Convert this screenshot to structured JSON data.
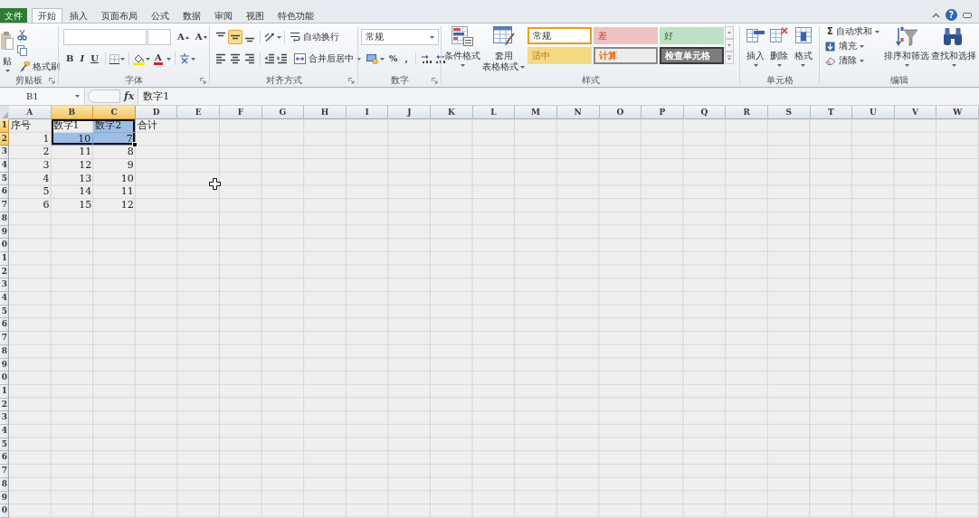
{
  "tabs": [
    {
      "label": "文件",
      "kind": "file",
      "selected": false
    },
    {
      "label": "开始",
      "kind": "tab",
      "selected": true
    },
    {
      "label": "插入",
      "kind": "tab",
      "selected": false
    },
    {
      "label": "页面布局",
      "kind": "tab",
      "selected": false
    },
    {
      "label": "公式",
      "kind": "tab",
      "selected": false
    },
    {
      "label": "数据",
      "kind": "tab",
      "selected": false
    },
    {
      "label": "审阅",
      "kind": "tab",
      "selected": false
    },
    {
      "label": "视图",
      "kind": "tab",
      "selected": false
    },
    {
      "label": "特色功能",
      "kind": "tab",
      "selected": false
    }
  ],
  "help_button": "?",
  "clipboard": {
    "label": "剪贴板",
    "paste": "贴",
    "format_painter": "格式刷"
  },
  "font": {
    "label": "字体",
    "grow": "A",
    "shrink": "A",
    "bold": "B",
    "italic": "I",
    "underline": "U",
    "font_color": "A"
  },
  "alignment": {
    "label": "对齐方式",
    "vertical": [
      {
        "selected": false
      },
      {
        "selected": true
      },
      {
        "selected": false
      }
    ],
    "wrap_text": "自动换行",
    "merge_center": "合并后居中"
  },
  "number": {
    "label": "数字",
    "format": "常规",
    "percent": "%",
    "comma": ","
  },
  "styles": {
    "label": "样式",
    "conditional": "条件格式",
    "table_format": [
      "套用",
      "表格格式"
    ],
    "gallery": [
      {
        "label": "常规",
        "kind": "normal",
        "selected": true
      },
      {
        "label": "差",
        "kind": "bad",
        "selected": false
      },
      {
        "label": "好",
        "kind": "good",
        "selected": false
      },
      {
        "label": "适中",
        "kind": "neutral",
        "selected": false
      },
      {
        "label": "计算",
        "kind": "calculation",
        "selected": false
      },
      {
        "label": "检查单元格",
        "kind": "check",
        "selected": false
      }
    ]
  },
  "cells": {
    "label": "单元格",
    "buttons": [
      "插入",
      "删除",
      "格式"
    ]
  },
  "editing": {
    "label": "编辑",
    "autosum_symbol": "Σ",
    "small_buttons": [
      "自动求和",
      "填充",
      "清除"
    ],
    "large_buttons": [
      "排序和筛选",
      "查找和选择"
    ]
  },
  "formula_bar": {
    "name_box": "B1",
    "function_button": "fx",
    "content": "数字1"
  },
  "sheet": {
    "columns": [
      {
        "label": "A",
        "selected": false
      },
      {
        "label": "B",
        "selected": true
      },
      {
        "label": "C",
        "selected": true
      },
      {
        "label": "D",
        "selected": false
      },
      {
        "label": "E",
        "selected": false
      },
      {
        "label": "F",
        "selected": false
      },
      {
        "label": "G",
        "selected": false
      },
      {
        "label": "H",
        "selected": false
      },
      {
        "label": "I",
        "selected": false
      },
      {
        "label": "J",
        "selected": false
      },
      {
        "label": "K",
        "selected": false
      },
      {
        "label": "L",
        "selected": false
      },
      {
        "label": "M",
        "selected": false
      },
      {
        "label": "N",
        "selected": false
      },
      {
        "label": "O",
        "selected": false
      },
      {
        "label": "P",
        "selected": false
      },
      {
        "label": "Q",
        "selected": false
      },
      {
        "label": "R",
        "selected": false
      },
      {
        "label": "S",
        "selected": false
      },
      {
        "label": "T",
        "selected": false
      },
      {
        "label": "U",
        "selected": false
      },
      {
        "label": "V",
        "selected": false
      },
      {
        "label": "W",
        "selected": false
      }
    ],
    "rows": [
      {
        "header": "1",
        "selected": true,
        "kind": "text",
        "cells": [
          "序号",
          "数字1",
          "数字2",
          "合计"
        ]
      },
      {
        "header": "2",
        "selected": true,
        "kind": "number",
        "cells": [
          "1",
          "10",
          "7"
        ]
      },
      {
        "header": "3",
        "selected": false,
        "kind": "number",
        "cells": [
          "2",
          "11",
          "8"
        ]
      },
      {
        "header": "4",
        "selected": false,
        "kind": "number",
        "cells": [
          "3",
          "12",
          "9"
        ]
      },
      {
        "header": "5",
        "selected": false,
        "kind": "number",
        "cells": [
          "4",
          "13",
          "10"
        ]
      },
      {
        "header": "6",
        "selected": false,
        "kind": "number",
        "cells": [
          "5",
          "14",
          "11"
        ]
      },
      {
        "header": "7",
        "selected": false,
        "kind": "number",
        "cells": [
          "6",
          "15",
          "12"
        ]
      },
      {
        "header": "8",
        "selected": false
      },
      {
        "header": "9",
        "selected": false
      },
      {
        "header": "0",
        "selected": false
      },
      {
        "header": "1",
        "selected": false
      },
      {
        "header": "2",
        "selected": false
      },
      {
        "header": "3",
        "selected": false
      },
      {
        "header": "4",
        "selected": false
      },
      {
        "header": "5",
        "selected": false
      },
      {
        "header": "6",
        "selected": false
      },
      {
        "header": "7",
        "selected": false
      },
      {
        "header": "8",
        "selected": false
      },
      {
        "header": "9",
        "selected": false
      },
      {
        "header": "0",
        "selected": false
      },
      {
        "header": "1",
        "selected": false
      },
      {
        "header": "2",
        "selected": false
      },
      {
        "header": "3",
        "selected": false
      },
      {
        "header": "4",
        "selected": false
      },
      {
        "header": "5",
        "selected": false
      },
      {
        "header": "6",
        "selected": false
      },
      {
        "header": "7",
        "selected": false
      },
      {
        "header": "8",
        "selected": false
      },
      {
        "header": "9",
        "selected": false
      },
      {
        "header": "0",
        "selected": false
      }
    ]
  }
}
